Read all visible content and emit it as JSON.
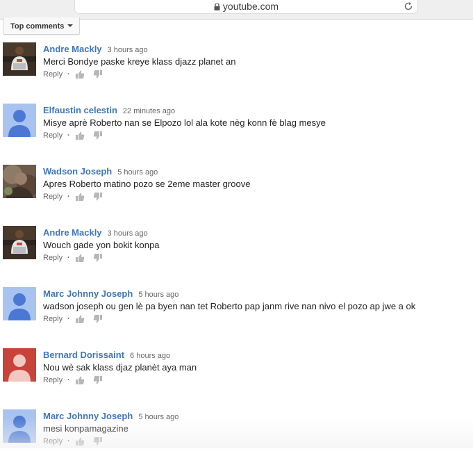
{
  "browser": {
    "url": "youtube.com"
  },
  "sort": {
    "label": "Top comments"
  },
  "comments": [
    {
      "author": "Andre Mackly",
      "time": "3 hours ago",
      "text": "Merci Bondye paske kreye klass djazz planet an",
      "reply": "Reply",
      "avatar": "photo-person-laptop"
    },
    {
      "author": "Elfaustin celestin",
      "time": "22 minutes ago",
      "text": "Misye aprè Roberto nan se Elpozo lol ala kote nèg konn fè blag mesye",
      "reply": "Reply",
      "avatar": "default-blue"
    },
    {
      "author": "Wadson Joseph",
      "time": "5 hours ago",
      "text": "Apres Roberto matino pozo se 2eme master groove",
      "reply": "Reply",
      "avatar": "photo-blurred"
    },
    {
      "author": "Andre Mackly",
      "time": "3 hours ago",
      "text": "Wouch gade yon bokit konpa",
      "reply": "Reply",
      "avatar": "photo-person-laptop"
    },
    {
      "author": "Marc Johnny Joseph",
      "time": "5 hours ago",
      "text": "wadson joseph ou gen lè pa byen nan tet Roberto pap janm rive nan nivo el pozo ap jwe a ok",
      "reply": "Reply",
      "avatar": "default-blue"
    },
    {
      "author": "Bernard Dorissaint",
      "time": "6 hours ago",
      "text": "Nou wè sak klass djaz planèt aya man",
      "reply": "Reply",
      "avatar": "default-red"
    },
    {
      "author": "Marc Johnny Joseph",
      "time": "5 hours ago",
      "text": "mesi konpamagazine",
      "reply": "Reply",
      "avatar": "default-blue"
    }
  ],
  "colors": {
    "author": "#3f77b8",
    "avatar_blue_bg": "#a9c3f0",
    "avatar_blue_fg": "#4a78d4",
    "avatar_red_bg": "#c8433a",
    "avatar_red_fg": "#f2c9c2"
  }
}
